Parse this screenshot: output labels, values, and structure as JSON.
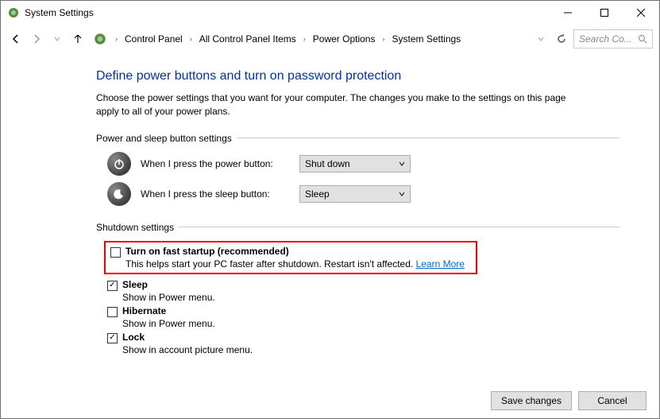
{
  "window": {
    "title": "System Settings"
  },
  "breadcrumb": {
    "items": [
      "Control Panel",
      "All Control Panel Items",
      "Power Options",
      "System Settings"
    ]
  },
  "search": {
    "placeholder": "Search Co..."
  },
  "page": {
    "heading": "Define power buttons and turn on password protection",
    "description": "Choose the power settings that you want for your computer. The changes you make to the settings on this page apply to all of your power plans."
  },
  "powerSleep": {
    "section_label": "Power and sleep button settings",
    "power_label": "When I press the power button:",
    "power_value": "Shut down",
    "sleep_label": "When I press the sleep button:",
    "sleep_value": "Sleep"
  },
  "shutdown": {
    "section_label": "Shutdown settings",
    "fast_startup": {
      "label": "Turn on fast startup (recommended)",
      "checked": false,
      "desc": "This helps start your PC faster after shutdown. Restart isn't affected. ",
      "link": "Learn More"
    },
    "sleep": {
      "label": "Sleep",
      "checked": true,
      "desc": "Show in Power menu."
    },
    "hibernate": {
      "label": "Hibernate",
      "checked": false,
      "desc": "Show in Power menu."
    },
    "lock": {
      "label": "Lock",
      "checked": true,
      "desc": "Show in account picture menu."
    }
  },
  "footer": {
    "save": "Save changes",
    "cancel": "Cancel"
  }
}
